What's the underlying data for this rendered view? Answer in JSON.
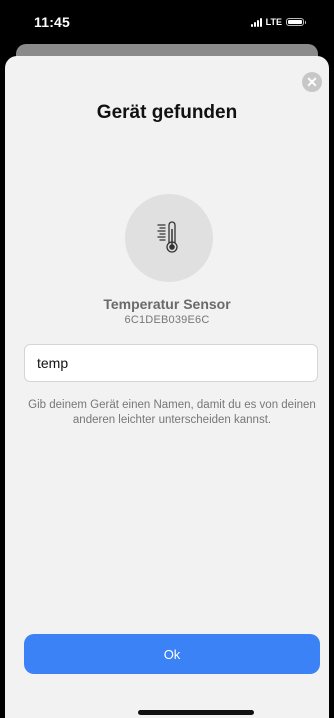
{
  "status_bar": {
    "time": "11:45",
    "network": "LTE"
  },
  "sheet": {
    "title": "Gerät gefunden",
    "close_icon": "close-icon",
    "device_icon": "thermometer-icon",
    "device_name": "Temperatur Sensor",
    "device_id": "6C1DEB039E6C",
    "name_input": {
      "value": "temp"
    },
    "helper_text": "Gib deinem Gerät einen Namen, damit du es von deinen anderen leichter unterscheiden kannst.",
    "ok_label": "Ok"
  },
  "colors": {
    "accent": "#3b82f6",
    "sheet_bg": "#f2f2f2"
  }
}
